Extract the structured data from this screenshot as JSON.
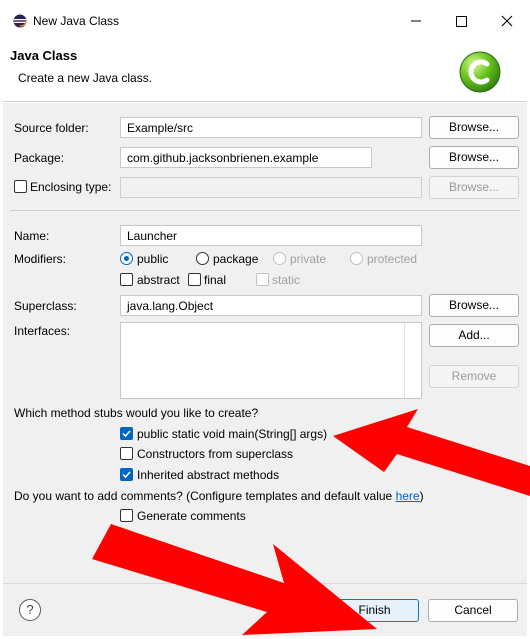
{
  "window": {
    "title": "New Java Class",
    "minimize_label": "minimize",
    "maximize_label": "maximize",
    "close_label": "close"
  },
  "header": {
    "title": "Java Class",
    "description": "Create a new Java class."
  },
  "form": {
    "source_folder": {
      "label": "Source folder:",
      "value": "Example/src",
      "browse": "Browse..."
    },
    "package": {
      "label": "Package:",
      "value": "com.github.jacksonbrienen.example",
      "browse": "Browse..."
    },
    "enclosing_type": {
      "label": "Enclosing type:",
      "value": "",
      "browse": "Browse...",
      "checked": false
    },
    "name": {
      "label": "Name:",
      "value": "Launcher"
    },
    "modifiers": {
      "label": "Modifiers:",
      "access": [
        "public",
        "package",
        "private",
        "protected"
      ],
      "selected": "public",
      "abstract": "abstract",
      "final": "final",
      "static": "static"
    },
    "superclass": {
      "label": "Superclass:",
      "value": "java.lang.Object",
      "browse": "Browse..."
    },
    "interfaces": {
      "label": "Interfaces:",
      "add": "Add...",
      "remove": "Remove"
    }
  },
  "stubs": {
    "question": "Which method stubs would you like to create?",
    "main": {
      "label": "public static void main(String[] args)",
      "checked": true
    },
    "constructors": {
      "label": "Constructors from superclass",
      "checked": false
    },
    "inherited": {
      "label": "Inherited abstract methods",
      "checked": true
    }
  },
  "comments": {
    "question": "Do you want to add comments? (Configure templates and default value ",
    "link": "here",
    "close_paren": ")",
    "generate": {
      "label": "Generate comments",
      "checked": false
    }
  },
  "footer": {
    "help": "?",
    "finish": "Finish",
    "cancel": "Cancel"
  },
  "colors": {
    "accent": "#0067c0",
    "arrow": "#ff0000"
  }
}
